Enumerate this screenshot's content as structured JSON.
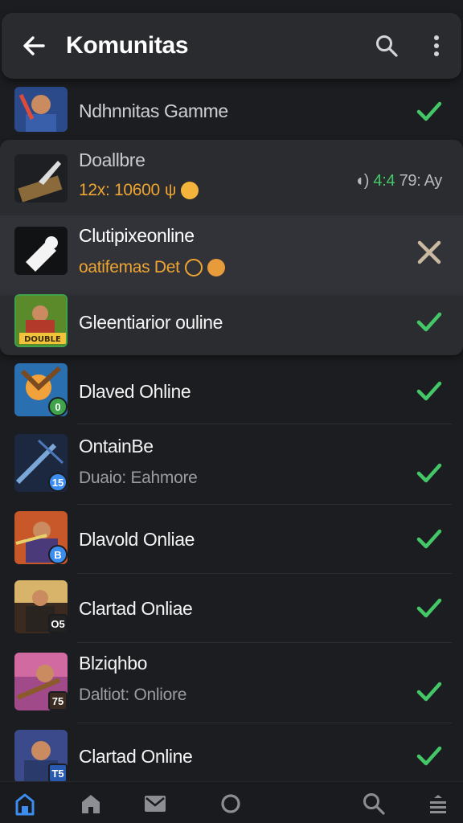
{
  "appbar": {
    "title": "Komunitas",
    "back_icon": "arrow-left-icon",
    "search_icon": "search-icon",
    "more_icon": "more-vertical-icon"
  },
  "rows": [
    {
      "name": "Ndhnnitas Gamme",
      "status": "check"
    },
    {
      "name": "Doallbre",
      "sub": "12x: 10600",
      "meta_prefix": "4:4",
      "meta_suffix": "79: Ay"
    },
    {
      "name": "Clutipixeonline",
      "sub": "oatifemas Det",
      "status": "cross"
    },
    {
      "name": "Gleentiarior ouline",
      "badge": "DOUBLE",
      "status": "check"
    },
    {
      "name": "Dlaved Ohline",
      "badge": "0",
      "status": "check"
    },
    {
      "name": "OntainBe",
      "sub": "Duaio: Eahmore",
      "badge": "15",
      "status": "check"
    },
    {
      "name": "Dlavold Onliae",
      "badge": "B",
      "status": "check"
    },
    {
      "name": "Clartad Onliae",
      "badge": "O5",
      "status": "check"
    },
    {
      "name": "Blziqhbo",
      "sub": "Daltiot: Onliore",
      "badge": "75",
      "status": "check"
    },
    {
      "name": "Clartad Online",
      "badge": "T5",
      "status": "check"
    }
  ],
  "colors": {
    "accent_green": "#44c767",
    "accent_blue": "#3b8ef0",
    "warning_orange": "#f0a531",
    "background": "#1c1d20"
  },
  "bottomnav": {
    "items": [
      "home-active-icon",
      "home-icon",
      "mail-icon",
      "circle-icon",
      "search-icon",
      "menu-icon"
    ]
  }
}
